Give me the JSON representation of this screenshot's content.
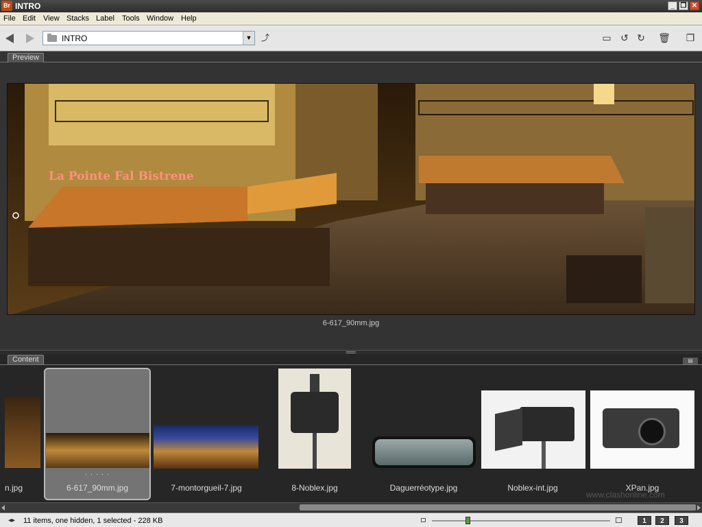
{
  "window": {
    "title": "INTRO",
    "logo": "Br"
  },
  "menu": [
    "File",
    "Edit",
    "View",
    "Stacks",
    "Label",
    "Tools",
    "Window",
    "Help"
  ],
  "toolbar": {
    "path": "INTRO",
    "icons": [
      "back-arrow",
      "forward-arrow",
      "folder",
      "up-folder",
      "new-folder",
      "rotate-left",
      "rotate-right",
      "trash",
      "compact-mode"
    ]
  },
  "preview": {
    "tab_label": "Preview",
    "caption": "6-617_90mm.jpg",
    "sign_text": "La Pointe Fal    Bistrene"
  },
  "content": {
    "tab_label": "Content",
    "items": [
      {
        "label": "n.jpg"
      },
      {
        "label": "6-617_90mm.jpg",
        "selected": true,
        "rating_dots": "· · · · ·"
      },
      {
        "label": "7-montorgueil-7.jpg"
      },
      {
        "label": "8-Noblex.jpg"
      },
      {
        "label": "Daguerréotype.jpg"
      },
      {
        "label": "Noblex-int.jpg"
      },
      {
        "label": "XPan.jpg"
      }
    ],
    "watermark": "www.clashonline.com"
  },
  "status": {
    "text": "11 items, one hidden, 1 selected - 228 KB",
    "view_buttons": [
      "1",
      "2",
      "3"
    ],
    "thumb_size_level": 0.19
  }
}
